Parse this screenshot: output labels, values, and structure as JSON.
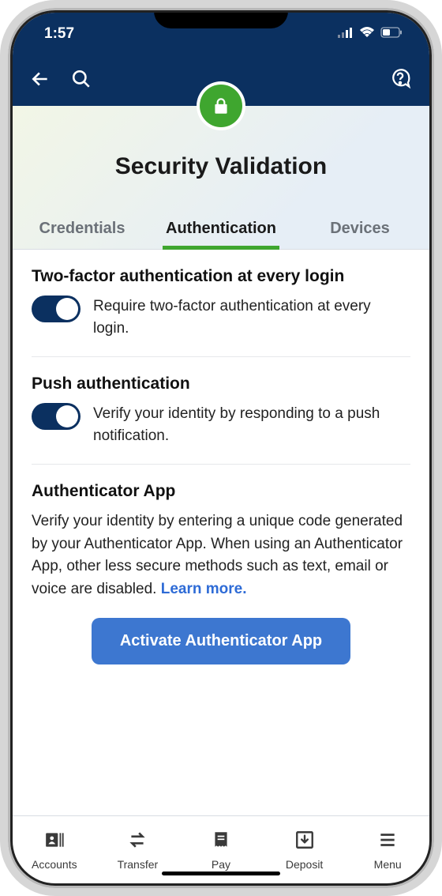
{
  "status": {
    "time": "1:57"
  },
  "page": {
    "title": "Security Validation"
  },
  "tabs": [
    {
      "label": "Credentials",
      "active": false
    },
    {
      "label": "Authentication",
      "active": true
    },
    {
      "label": "Devices",
      "active": false
    }
  ],
  "sections": {
    "twofa": {
      "title": "Two-factor authentication at every login",
      "desc": "Require two-factor authentication at every login.",
      "on": true
    },
    "push": {
      "title": "Push authentication",
      "desc": "Verify your identity by responding to a push notification.",
      "on": true
    },
    "authapp": {
      "title": "Authenticator App",
      "body": "Verify your identity by entering a unique code generated by your Authenticator App. When using an Authenticator App, other less secure methods such as text, email or voice are disabled. ",
      "link": "Learn more.",
      "cta": "Activate Authenticator App"
    }
  },
  "nav": [
    {
      "label": "Accounts"
    },
    {
      "label": "Transfer"
    },
    {
      "label": "Pay"
    },
    {
      "label": "Deposit"
    },
    {
      "label": "Menu"
    }
  ]
}
